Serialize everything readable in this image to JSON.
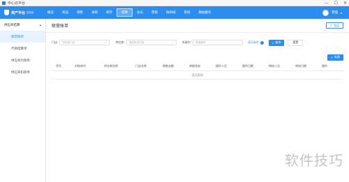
{
  "window": {
    "title": "中心云平台",
    "controls": [
      "—",
      "☐",
      "✕"
    ]
  },
  "logo": {
    "name": "资产平台",
    "sub": "智慧版"
  },
  "nav": {
    "items": [
      {
        "label": "概览",
        "active": false
      },
      {
        "label": "商品",
        "active": false
      },
      {
        "label": "销售",
        "active": false
      },
      {
        "label": "采购",
        "active": false
      },
      {
        "label": "库存",
        "active": false
      },
      {
        "label": "结算",
        "active": true
      },
      {
        "label": "会员",
        "active": false
      },
      {
        "label": "营销",
        "active": false
      },
      {
        "label": "微商城",
        "active": false
      },
      {
        "label": "系统",
        "active": false
      },
      {
        "label": "数据服务",
        "active": false
      }
    ]
  },
  "user": {
    "name": "管理",
    "caret": "▾"
  },
  "sidebar": {
    "group": "供应商结算",
    "caret": "▴",
    "items": [
      {
        "label": "联营账单",
        "active": true
      },
      {
        "label": "代销结算单",
        "active": false
      },
      {
        "label": "供应商付款单",
        "active": false
      },
      {
        "label": "供应商扣款单",
        "active": false
      }
    ]
  },
  "page": {
    "title": "联营账单",
    "export_label": "导出",
    "export_icon": "⇪"
  },
  "filter": {
    "store_label": "门店:",
    "store_placeholder": "请选择门店",
    "supplier_label": "供应商:",
    "supplier_placeholder": "请选择供应商",
    "keyword_label": "关键字:",
    "keyword_placeholder": "单据编号",
    "show_conditions": "显示条件",
    "search_label": "查询",
    "search_icon": "⌕",
    "reset_label": "重置",
    "chevron": "⌄"
  },
  "toolbar": {
    "add_label": "新建",
    "add_icon": "+"
  },
  "table": {
    "columns": [
      "序号",
      "对账单号",
      "供应商名称",
      "门店名称",
      "销售金额",
      "单据状态",
      "操作人员",
      "操作日期",
      "审核人员",
      "审核日期",
      "操作"
    ],
    "empty_text": "暂无数据"
  },
  "watermark": "软件技巧"
}
